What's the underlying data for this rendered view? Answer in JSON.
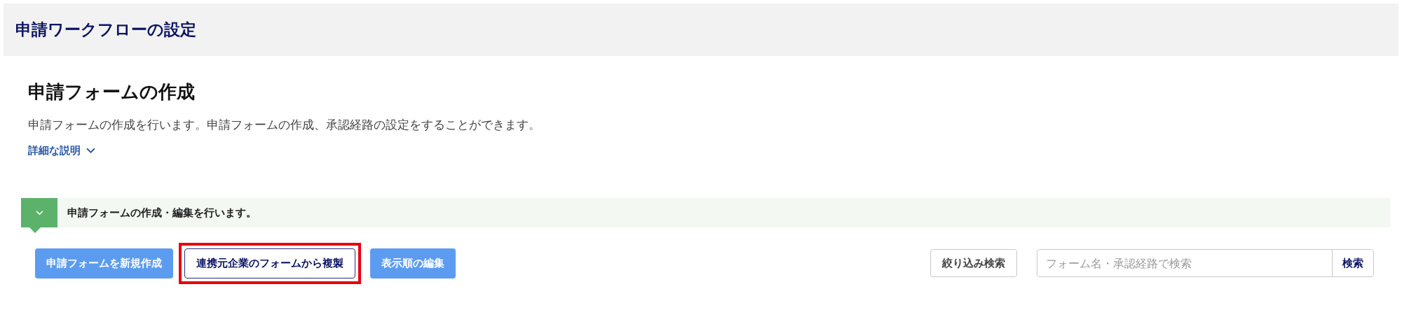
{
  "header": {
    "title": "申請ワークフローの設定"
  },
  "section": {
    "title": "申請フォームの作成",
    "description": "申請フォームの作成を行います。申請フォームの作成、承認経路の設定をすることができます。",
    "details_link": {
      "label": "詳細な説明",
      "expanded": false
    }
  },
  "notice": {
    "text": "申請フォームの作成・編集を行います。"
  },
  "actions": [
    {
      "label": "申請フォームを新規作成",
      "kind": "primary",
      "highlighted": false
    },
    {
      "label": "連携元企業のフォームから複製",
      "kind": "outline",
      "highlighted": true
    },
    {
      "label": "表示順の編集",
      "kind": "primary",
      "highlighted": false
    }
  ],
  "filter_button": {
    "label": "絞り込み検索"
  },
  "search": {
    "placeholder": "フォーム名・承認経路で検索",
    "button": "検索"
  }
}
